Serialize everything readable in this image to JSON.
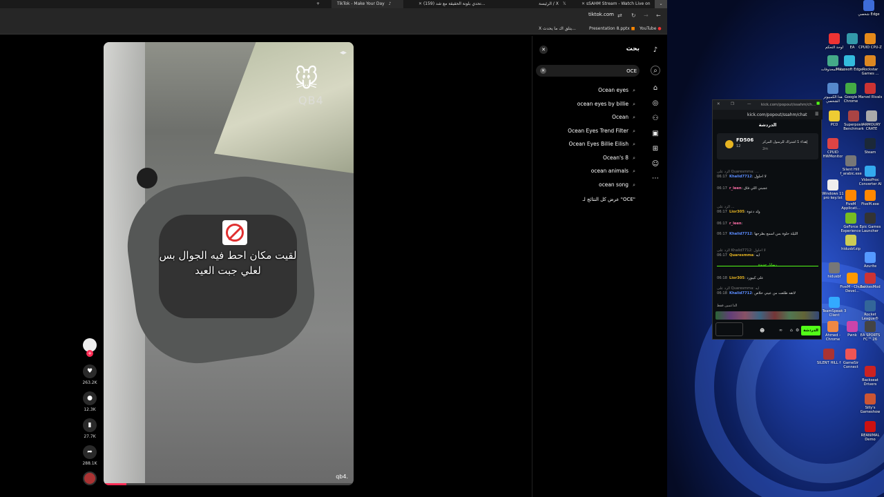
{
  "tabs": [
    {
      "label": "+"
    },
    {
      "label": "TikTok - Make Your Day"
    },
    {
      "label": "(159) تحدي بلونة الحقيقة مع شد..."
    },
    {
      "label": "الرئيسة / X"
    },
    {
      "label": "sSAHM Stream - Watch Live on"
    }
  ],
  "address": {
    "domain": "tiktok.com"
  },
  "bookmarks": [
    {
      "label": "YouTube"
    },
    {
      "label": "Presentation 8.pptx"
    },
    {
      "label": "X  يتلق اك ما يحدث..."
    }
  ],
  "video": {
    "caption_line1": "لقيت مكان احط فيه الجوال بس",
    "caption_line2": "لعلي جبت العيد",
    "watermark": "QB4",
    "bottom_watermark": "qb4.",
    "progress_fraction": 0.09
  },
  "actions": {
    "likes": "263.2K",
    "comments": "12.3K",
    "saves": "27.7K",
    "shares": "288.1K"
  },
  "search_panel": {
    "title": "بحث",
    "query": "OCE",
    "suggestions": [
      "Ocean eyes",
      "ocean eyes by billie",
      "Ocean",
      "Ocean Eyes Trend Filter",
      "Ocean Eyes Billie Eilish",
      "Ocean's 8",
      "ocean animals",
      "ocean song"
    ],
    "show_all": "عرض كل النتائج لـ \"OCE\""
  },
  "desktop_icons": [
    {
      "label": "شخصي Edge"
    },
    {
      "label": "لوحة التحكم"
    },
    {
      "label": "EA"
    },
    {
      "label": "CPUID CPU-Z"
    },
    {
      "label": "سلة المحذوفات"
    },
    {
      "label": "Microsoft Edge"
    },
    {
      "label": "Rockstar Games ..."
    },
    {
      "label": "هذا الكمبيوتر الشخصي"
    },
    {
      "label": "Google Chrome"
    },
    {
      "label": "Marvel Rivals"
    },
    {
      "label": "PCD"
    },
    {
      "label": "Superposit Benchmark"
    },
    {
      "label": "ARMOURY CRATE"
    },
    {
      "label": "CPUID HWMonitor"
    },
    {
      "label": "Steam"
    },
    {
      "label": "Silent Hill f_arabic.exe"
    },
    {
      "label": "VideoProc Converter AI"
    },
    {
      "label": "Windows 11 pro key.txt"
    },
    {
      "label": "FiveM Applicati..."
    },
    {
      "label": "FiveM.exe"
    },
    {
      "label": "GeForce Experience"
    },
    {
      "label": "Epic Games Launcher"
    },
    {
      "label": "hidusbf.zip"
    },
    {
      "label": "Azurite"
    },
    {
      "label": "hidusbf"
    },
    {
      "label": "FiveM - Chute Devel..."
    },
    {
      "label": "BakkesMod"
    },
    {
      "label": "TeamSpeak 3 Client"
    },
    {
      "label": "Rocket League®"
    },
    {
      "label": "Ahmed - Chrome"
    },
    {
      "label": "Pwnk"
    },
    {
      "label": "EA SPORTS FC™ 26"
    },
    {
      "label": "SILENT HILL f"
    },
    {
      "label": "GameSir Connect"
    },
    {
      "label": "Backseat Drivers"
    },
    {
      "label": "Silly's Gameshow"
    },
    {
      "label": "REANIMAL Demo"
    }
  ],
  "chat": {
    "window_title": "kick.com/popout/ssahm/ch...",
    "url": "kick.com/popout/ssahm/chat",
    "header": "الدردشة",
    "pinned_user": "FD506",
    "pinned_count": "12",
    "pinned_text": "إهداء 1 اشتراك للرسول المركز",
    "pinned_time": "2m",
    "messages": [
      {
        "time": "06:17",
        "user": "Khalid7712",
        "text": "لا احلول",
        "reply": "الرد على Quaresmma: ..."
      },
      {
        "time": "06:17",
        "user": "r_leen",
        "text": "عجبني اللي فاق",
        "reply": ""
      },
      {
        "time": "06:17",
        "user": "Lior305",
        "text": "ولد دعوة",
        "reply": "الرد على ..."
      },
      {
        "time": "06:17",
        "user": "r_leen",
        "text": "",
        "reply": ""
      },
      {
        "time": "06:17",
        "user": "Khalid7712",
        "text": "الليلة حلوة بس اسمع بطرحها",
        "reply": ""
      },
      {
        "time": "06:17",
        "user": "Quaresmma",
        "text": "ايه",
        "reply": "الرد على Khalid7712: لا احلول"
      }
    ],
    "new_messages": "رسائل جديدة",
    "messages_after": [
      {
        "time": "06:18",
        "user": "Lior305",
        "text": "على كيبورد",
        "reply": ""
      },
      {
        "time": "06:18",
        "user": "Khalid7712",
        "text": "لاتقه طلعت من عيني خلاص",
        "reply": "الرد على Quaresmma: ايه"
      }
    ],
    "supporters_label": "الداعمين فقط",
    "send_label": "الدردشة"
  },
  "colors": {
    "tiktok_red": "#fe2c55",
    "kick_green": "#53fc18"
  }
}
